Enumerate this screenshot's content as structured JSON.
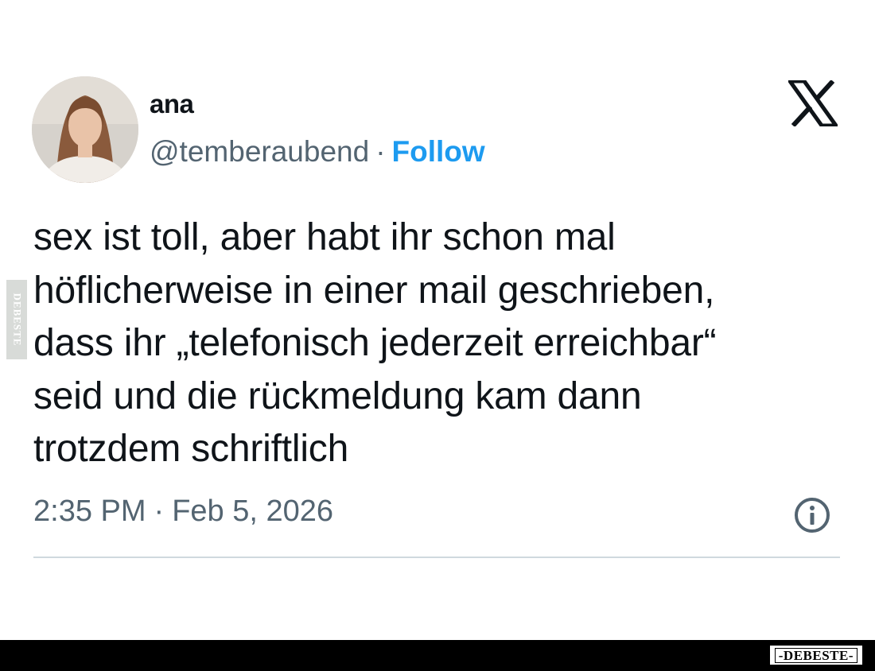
{
  "tweet": {
    "display_name": "ana",
    "handle": "@temberaubend",
    "separator": "·",
    "follow_label": "Follow",
    "platform_icon": "x-logo-icon",
    "text": "sex ist toll, aber habt ihr schon mal\nhöflicherweise in einer mail geschrieben,\ndass ihr „telefonisch jederzeit erreichbar“\nseid und die rückmeldung kam dann\ntrotzdem schriftlich",
    "time": "2:35 PM",
    "date": "Feb 5, 2026",
    "info_icon": "info-icon"
  },
  "watermark": {
    "side_text": "DEBESTE",
    "footer_brand": "-DEBESTE-"
  },
  "colors": {
    "text": "#0f1419",
    "secondary": "#536471",
    "follow": "#1d9bf0",
    "divider": "#cfd9de",
    "footer": "#000000"
  }
}
